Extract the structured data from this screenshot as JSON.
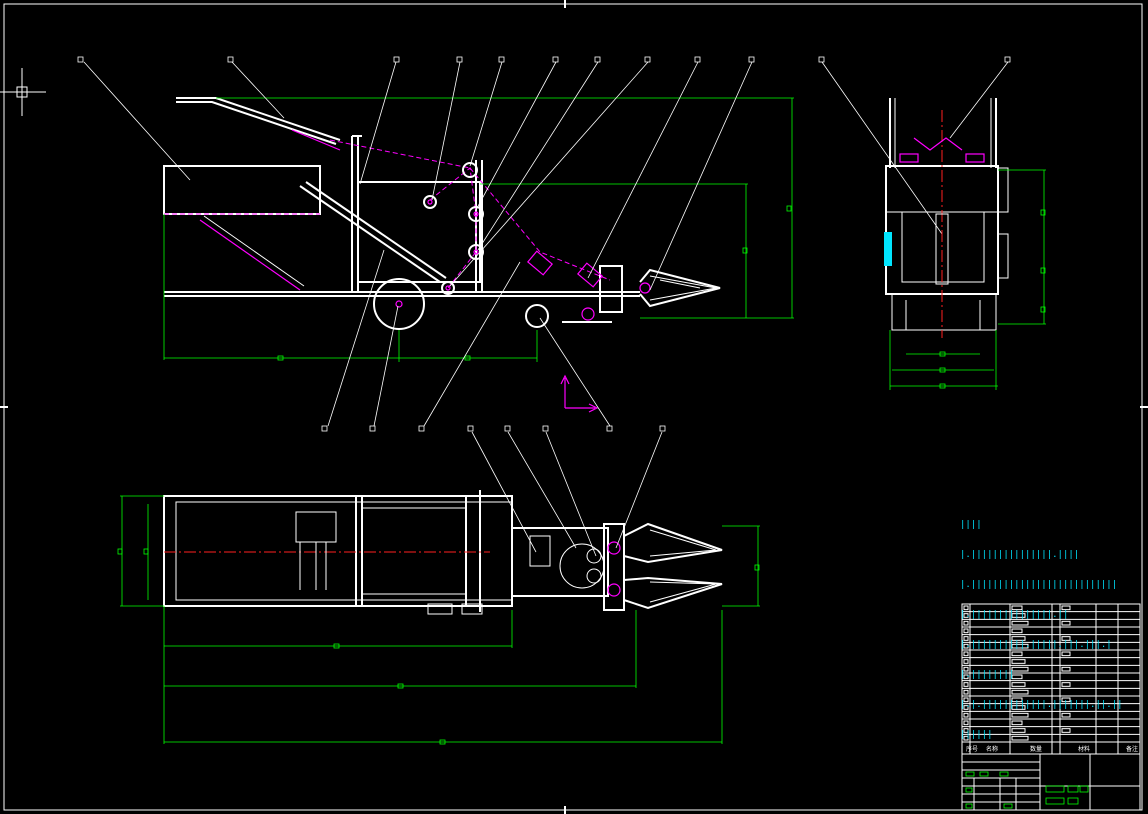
{
  "colors": {
    "background": "#000000",
    "outline": "#ffffff",
    "dimension": "#00ff00",
    "hidden": "#ff00ff",
    "centerline": "#ff2020",
    "notes": "#00e5ff"
  },
  "technical_notes": {
    "lines": [
      "||||",
      "|.|||||||||||||||.||||",
      "|.|||||||||||||||||||||||||||",
      "|.|||||||||||||||.||",
      "|.||||||||||.|||||.|||.|||.|",
      "|.||||||||",
      "|.|.||||||||||||.|||||||.||.||",
      "||||||"
    ]
  },
  "title_block": {
    "header_labels": [
      "序号",
      "名称",
      "数量",
      "材料",
      "备注"
    ]
  }
}
